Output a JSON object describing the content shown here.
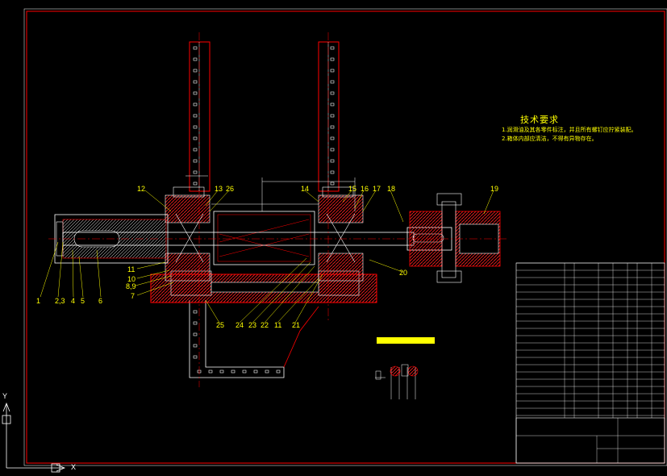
{
  "drawing": {
    "tech_requirements": {
      "title": "技术要求",
      "line1": "1.润滑油及其各零件标注，并且所有螺钉应拧紧装配。",
      "line2": "2.箱体内部应清洁，不得有异物存在。"
    },
    "callouts": {
      "c1": "1",
      "c2": "2,3",
      "c4": "4",
      "c5": "5",
      "c6": "6",
      "c7": "7",
      "c8": "8,9",
      "c10": "10",
      "c11a": "11",
      "c11b": "11",
      "c12": "12",
      "c13": "13",
      "c14": "14",
      "c15": "15",
      "c16": "16",
      "c17": "17",
      "c18": "18",
      "c19": "19",
      "c20": "20",
      "c21": "21",
      "c22": "22",
      "c23": "23",
      "c24": "24",
      "c25": "25",
      "c26": "26"
    },
    "ucs": {
      "y": "Y",
      "x": "X"
    },
    "colors": {
      "frame": "#ff0000",
      "outline": "#ffffff",
      "section": "#ff0000",
      "centerline": "#ff0000",
      "text": "#ffff00",
      "dimension": "#ffffff"
    }
  }
}
